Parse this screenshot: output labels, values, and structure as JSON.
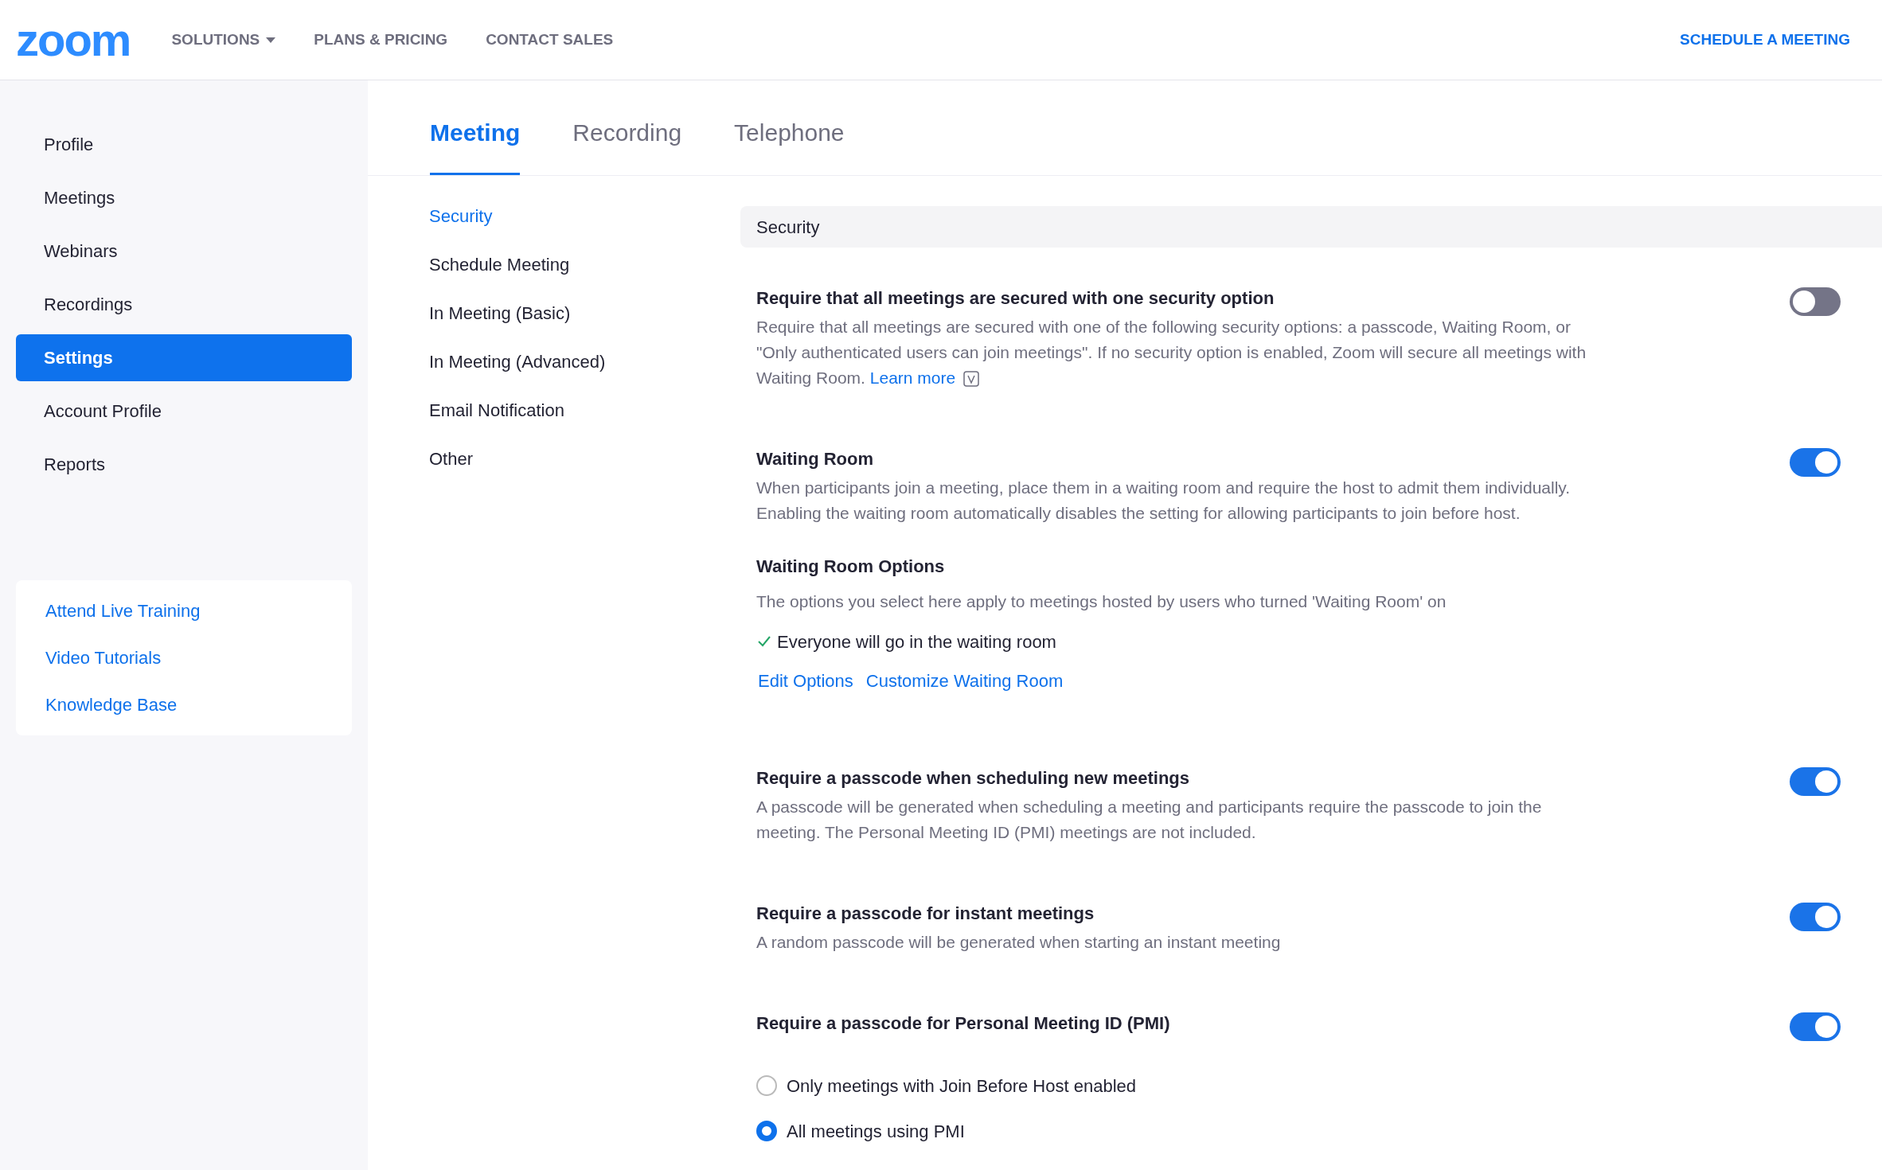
{
  "header": {
    "logo": "zoom",
    "nav": [
      {
        "label": "SOLUTIONS",
        "dropdown": true
      },
      {
        "label": "PLANS & PRICING",
        "dropdown": false
      },
      {
        "label": "CONTACT SALES",
        "dropdown": false
      }
    ],
    "action": "SCHEDULE A MEETING"
  },
  "sidebar": {
    "items": [
      {
        "label": "Profile",
        "selected": false
      },
      {
        "label": "Meetings",
        "selected": false
      },
      {
        "label": "Webinars",
        "selected": false
      },
      {
        "label": "Recordings",
        "selected": false
      },
      {
        "label": "Settings",
        "selected": true
      },
      {
        "label": "Account Profile",
        "selected": false
      },
      {
        "label": "Reports",
        "selected": false
      }
    ],
    "help_links": [
      "Attend Live Training",
      "Video Tutorials",
      "Knowledge Base"
    ]
  },
  "tabs": [
    {
      "label": "Meeting",
      "selected": true
    },
    {
      "label": "Recording",
      "selected": false
    },
    {
      "label": "Telephone",
      "selected": false
    }
  ],
  "subnav": [
    {
      "label": "Security",
      "selected": true
    },
    {
      "label": "Schedule Meeting",
      "selected": false
    },
    {
      "label": "In Meeting (Basic)",
      "selected": false
    },
    {
      "label": "In Meeting (Advanced)",
      "selected": false
    },
    {
      "label": "Email Notification",
      "selected": false
    },
    {
      "label": "Other",
      "selected": false
    }
  ],
  "section": {
    "title": "Security",
    "settings": [
      {
        "title": "Require that all meetings are secured with one security option",
        "description": "Require that all meetings are secured with one of the following security options: a passcode, Waiting Room, or \"Only authenticated users can join meetings\". If no security option is enabled, Zoom will secure all meetings with Waiting Room.",
        "link": "Learn more",
        "on": false
      },
      {
        "title": "Waiting Room",
        "description": "When participants join a meeting, place them in a waiting room and require the host to admit them individually. Enabling the waiting room automatically disables the setting for allowing participants to join before host.",
        "on": true,
        "options": {
          "title": "Waiting Room Options",
          "description": "The options you select here apply to meetings hosted by users who turned 'Waiting Room' on",
          "items": [
            {
              "label": "Everyone will go in the waiting room",
              "checked": true
            }
          ],
          "links": [
            "Edit Options",
            "Customize Waiting Room"
          ]
        }
      },
      {
        "title": "Require a passcode when scheduling new meetings",
        "description": "A passcode will be generated when scheduling a meeting and participants require the passcode to join the meeting. The Personal Meeting ID (PMI) meetings are not included.",
        "on": true
      },
      {
        "title": "Require a passcode for instant meetings",
        "description": "A random passcode will be generated when starting an instant meeting",
        "on": true
      },
      {
        "title": "Require a passcode for Personal Meeting ID (PMI)",
        "on": true,
        "radios": [
          {
            "label": "Only meetings with Join Before Host enabled",
            "selected": false
          },
          {
            "label": "All meetings using PMI",
            "selected": true
          }
        ]
      }
    ]
  }
}
